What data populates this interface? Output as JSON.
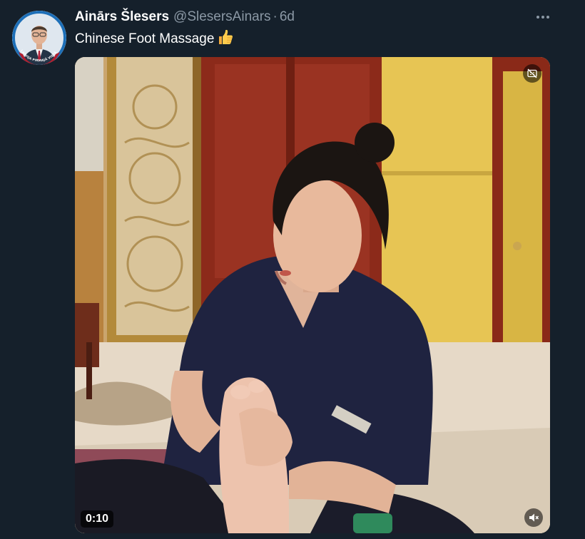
{
  "tweet": {
    "author_name": "Ainārs Šlesers",
    "handle": "@SlesersAinars",
    "separator": "·",
    "time": "6d",
    "text": "Chinese Foot Massage",
    "emoji": "thumbs-up-emoji"
  },
  "video": {
    "duration": "0:10",
    "top_icon": "no-captions-icon",
    "bottom_icon": "muted-speaker-icon"
  },
  "avatar": {
    "badge_text": "LATVIJA PIRMAJĀ VIETĀ"
  },
  "colors": {
    "background": "#15202b",
    "primary_text": "#ffffff",
    "secondary_text": "#8b98a5"
  }
}
